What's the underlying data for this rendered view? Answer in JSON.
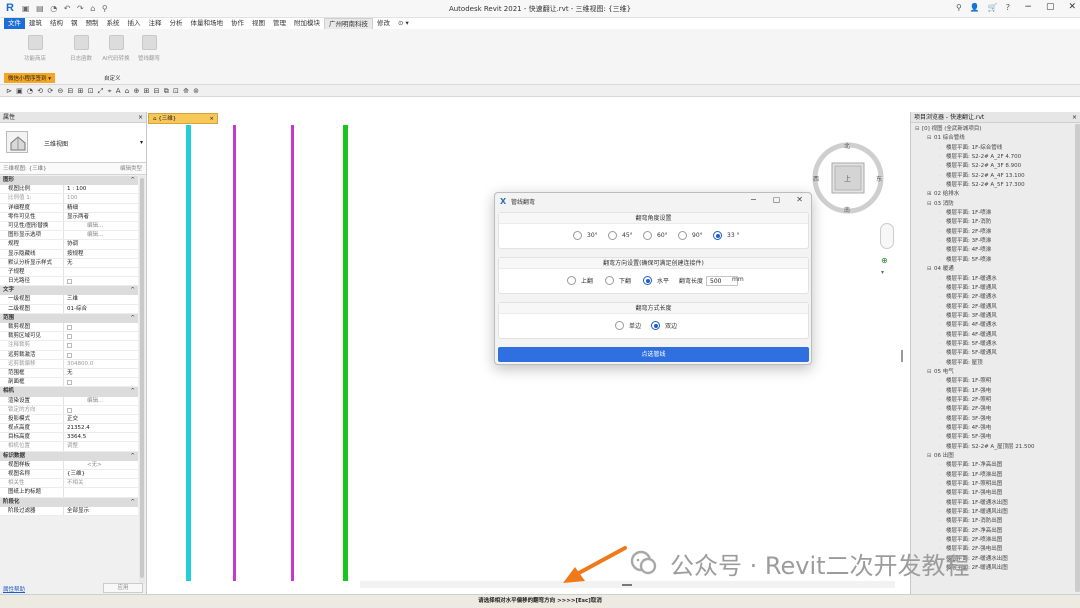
{
  "app": {
    "title": "Autodesk Revit 2021 - 快速翻让.rvt - 三维视图: {三维}",
    "logo_letter": "R",
    "qat_icons": "▣ ▤ ◔ ↶ ↷ ⌂ ⚲",
    "right_icons": [
      "⚲",
      "👤",
      "🛒",
      "?"
    ],
    "window_controls": [
      "−",
      "▢",
      "✕"
    ]
  },
  "menu": {
    "tabs": [
      "文件",
      "建筑",
      "结构",
      "钢",
      "预制",
      "系统",
      "插入",
      "注释",
      "分析",
      "体量和场地",
      "协作",
      "视图",
      "管理",
      "附加模块",
      "广州明南科技",
      "修改",
      "⊙ ▾"
    ],
    "active_index": 14
  },
  "ribbon": {
    "buttons": [
      "功能商店",
      "日志函数",
      "AI代码转换",
      "管线翻弯"
    ],
    "panel_label": "微信小程序签到 ▾",
    "panel_label2": "自定义"
  },
  "toolbar": {
    "icons": "⊳ ▣ ◔ ⟲ ⟳ ⊖ ⊟ ⊞ ⊡ ⤢ ⌖ A ⌂ ⊕ ⊞ ⊟ ⧉ ⊡ ⟰ ⊚"
  },
  "properties": {
    "title": "属性",
    "close": "×",
    "type_name": "三维视图",
    "selector": "三维视图: {三维}",
    "edit_type": "编辑类型",
    "apply_label": "应用",
    "help_label": "属性帮助",
    "rows": [
      {
        "group": "图形"
      },
      {
        "k": "视图比例",
        "v": "1 : 100"
      },
      {
        "k": "比例值 1:",
        "v": "100",
        "dim": true
      },
      {
        "k": "详细程度",
        "v": "精细"
      },
      {
        "k": "零件可见性",
        "v": "显示两者"
      },
      {
        "k": "可见性/图形替换",
        "v": "",
        "btn": "编辑..."
      },
      {
        "k": "图形显示选项",
        "v": "",
        "btn": "编辑..."
      },
      {
        "k": "规程",
        "v": "协调"
      },
      {
        "k": "显示隐藏线",
        "v": "按规程"
      },
      {
        "k": "默认分析显示样式",
        "v": "无"
      },
      {
        "k": "子规程",
        "v": ""
      },
      {
        "k": "日光路径",
        "v": "",
        "cb": true
      },
      {
        "group": "文字"
      },
      {
        "k": "一级视图",
        "v": "三维"
      },
      {
        "k": "二级视图",
        "v": "01-综合"
      },
      {
        "group": "范围"
      },
      {
        "k": "裁剪视图",
        "v": "",
        "cb": true
      },
      {
        "k": "裁剪区域可见",
        "v": "",
        "cb": true
      },
      {
        "k": "注释裁剪",
        "v": "",
        "cb": true,
        "dim": true
      },
      {
        "k": "远剪裁激活",
        "v": "",
        "cb": true
      },
      {
        "k": "远剪裁偏移",
        "v": "304800.0",
        "dim": true
      },
      {
        "k": "范围框",
        "v": "无"
      },
      {
        "k": "剖面框",
        "v": "",
        "cb": true
      },
      {
        "group": "相机"
      },
      {
        "k": "渲染设置",
        "v": "",
        "btn": "编辑..."
      },
      {
        "k": "锁定的方向",
        "v": "",
        "cb": true,
        "dim": true
      },
      {
        "k": "投影模式",
        "v": "正交"
      },
      {
        "k": "视点高度",
        "v": "21352.4"
      },
      {
        "k": "目标高度",
        "v": "3364.5"
      },
      {
        "k": "相机位置",
        "v": "调整",
        "dim": true
      },
      {
        "group": "标识数据"
      },
      {
        "k": "视图样板",
        "v": "",
        "btn": "<无>"
      },
      {
        "k": "视图名称",
        "v": "{三维}"
      },
      {
        "k": "相关性",
        "v": "不相关",
        "dim": true
      },
      {
        "k": "图纸上的标题",
        "v": ""
      },
      {
        "group": "阶段化"
      },
      {
        "k": "阶段过滤器",
        "v": "全部显示"
      }
    ]
  },
  "view_tab": {
    "label": "{三维}",
    "close": "×"
  },
  "pipes": [
    {
      "color": "#22cfd6"
    },
    {
      "color": "#c23bcf"
    },
    {
      "color": "#c23bcf"
    },
    {
      "color": "#19c51c"
    }
  ],
  "viewcube": {
    "top": "北",
    "bottom": "南",
    "left": "西",
    "right": "东",
    "face": "上"
  },
  "dialog": {
    "title": "管线翻弯",
    "controls": [
      "−",
      "▢",
      "✕"
    ],
    "angle_section": "翻弯角度设置",
    "angles": [
      "30°",
      "45°",
      "60°",
      "90°",
      "33 °"
    ],
    "angle_selected": 4,
    "dir_section": "翻弯方向设置(确保可满足创建连接件)",
    "dirs": [
      "上翻",
      "下翻",
      "水平"
    ],
    "dir_selected": 2,
    "length_label": "翻弯长度",
    "length_value": "500",
    "length_unit": "mm",
    "mode_section": "翻弯方式长度",
    "modes": [
      "单边",
      "双边"
    ],
    "mode_selected": 1,
    "pick_button": "点选管线"
  },
  "browser": {
    "title": "项目浏览器 - 快速翻让.rvt",
    "close": "×",
    "tree": [
      {
        "lvl": 0,
        "tog": "⊟",
        "t": "[0] 视图 (全武新城项目)"
      },
      {
        "lvl": 1,
        "tog": "⊟",
        "t": "01 综合管线"
      },
      {
        "lvl": 2,
        "t": "楼层平面: 1F-综合管线"
      },
      {
        "lvl": 2,
        "t": "楼层平面: S2-2# A_2F 4.700"
      },
      {
        "lvl": 2,
        "t": "楼层平面: S2-2# A_3F 8.900"
      },
      {
        "lvl": 2,
        "t": "楼层平面: S2-2# A_4F 13.100"
      },
      {
        "lvl": 2,
        "t": "楼层平面: S2-2# A_5F 17.300"
      },
      {
        "lvl": 1,
        "tog": "⊞",
        "t": "02 给排水"
      },
      {
        "lvl": 1,
        "tog": "⊟",
        "t": "03 消防"
      },
      {
        "lvl": 2,
        "t": "楼层平面: 1F-喷淋"
      },
      {
        "lvl": 2,
        "t": "楼层平面: 1F-消防"
      },
      {
        "lvl": 2,
        "t": "楼层平面: 2F-喷淋"
      },
      {
        "lvl": 2,
        "t": "楼层平面: 3F-喷淋"
      },
      {
        "lvl": 2,
        "t": "楼层平面: 4F-喷淋"
      },
      {
        "lvl": 2,
        "t": "楼层平面: 5F-喷淋"
      },
      {
        "lvl": 1,
        "tog": "⊟",
        "t": "04 暖通"
      },
      {
        "lvl": 2,
        "t": "楼层平面: 1F-暖通水"
      },
      {
        "lvl": 2,
        "t": "楼层平面: 1F-暖通风"
      },
      {
        "lvl": 2,
        "t": "楼层平面: 2F-暖通水"
      },
      {
        "lvl": 2,
        "t": "楼层平面: 2F-暖通风"
      },
      {
        "lvl": 2,
        "t": "楼层平面: 3F-暖通风"
      },
      {
        "lvl": 2,
        "t": "楼层平面: 4F-暖通水"
      },
      {
        "lvl": 2,
        "t": "楼层平面: 4F-暖通风"
      },
      {
        "lvl": 2,
        "t": "楼层平面: 5F-暖通水"
      },
      {
        "lvl": 2,
        "t": "楼层平面: 5F-暖通风"
      },
      {
        "lvl": 2,
        "t": "楼层平面: 屋顶"
      },
      {
        "lvl": 1,
        "tog": "⊟",
        "t": "05 电气"
      },
      {
        "lvl": 2,
        "t": "楼层平面: 1F-照明"
      },
      {
        "lvl": 2,
        "t": "楼层平面: 1F-强电"
      },
      {
        "lvl": 2,
        "t": "楼层平面: 2F-照明"
      },
      {
        "lvl": 2,
        "t": "楼层平面: 2F-强电"
      },
      {
        "lvl": 2,
        "t": "楼层平面: 3F-强电"
      },
      {
        "lvl": 2,
        "t": "楼层平面: 4F-强电"
      },
      {
        "lvl": 2,
        "t": "楼层平面: 5F-强电"
      },
      {
        "lvl": 2,
        "t": "楼层平面: S2-2# A_屋顶层 21.500"
      },
      {
        "lvl": 1,
        "tog": "⊟",
        "t": "06 出图"
      },
      {
        "lvl": 2,
        "t": "楼层平面: 1F-净高出图"
      },
      {
        "lvl": 2,
        "t": "楼层平面: 1F-喷淋出图"
      },
      {
        "lvl": 2,
        "t": "楼层平面: 1F-照明出图"
      },
      {
        "lvl": 2,
        "t": "楼层平面: 1F-强电出图"
      },
      {
        "lvl": 2,
        "t": "楼层平面: 1F-暖通水出图"
      },
      {
        "lvl": 2,
        "t": "楼层平面: 1F-暖通风出图"
      },
      {
        "lvl": 2,
        "t": "楼层平面: 1F-消防出图"
      },
      {
        "lvl": 2,
        "t": "楼层平面: 2F-净高出图"
      },
      {
        "lvl": 2,
        "t": "楼层平面: 2F-喷淋出图"
      },
      {
        "lvl": 2,
        "t": "楼层平面: 2F-强电出图"
      },
      {
        "lvl": 2,
        "t": "楼层平面: 2F-暖通水出图"
      },
      {
        "lvl": 2,
        "t": "楼层平面: 2F-暖通风出图"
      }
    ]
  },
  "status": {
    "text": "请选择相对水平偏移的翻弯方向 >>>>[Esc]取消"
  },
  "watermark": {
    "text": "公众号 · Revit二次开发教程"
  }
}
